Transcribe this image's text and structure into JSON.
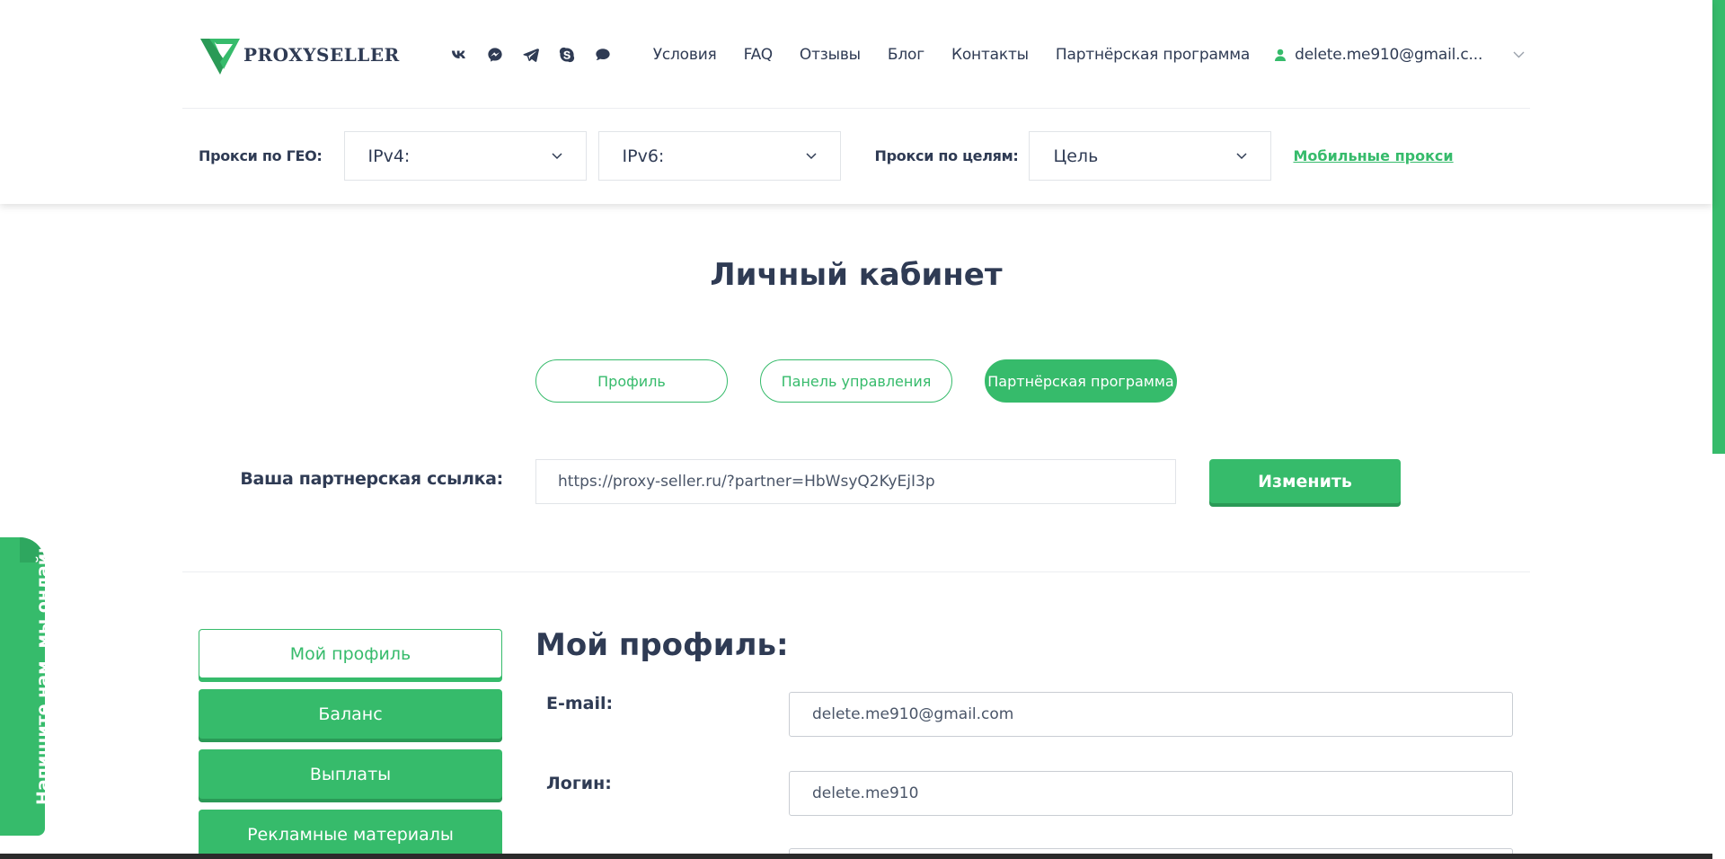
{
  "brand": {
    "name": "PROXYSELLER",
    "accent": "#36bb6b",
    "text_color": "#2f3b54"
  },
  "socials": [
    {
      "name": "vk-icon"
    },
    {
      "name": "messenger-icon"
    },
    {
      "name": "telegram-icon"
    },
    {
      "name": "skype-icon"
    },
    {
      "name": "chat-icon"
    }
  ],
  "nav": {
    "items": [
      "Условия",
      "FAQ",
      "Отзывы",
      "Блог",
      "Контакты",
      "Партнёрская программа"
    ],
    "user_email": "delete.me910@gmail.c..."
  },
  "geo_bar": {
    "geo_label": "Прокси по ГЕО:",
    "ipv4": "IPv4:",
    "ipv6": "IPv6:",
    "goal_label": "Прокси по целям:",
    "goal": "Цель",
    "mobile_link": "Мобильные прокси"
  },
  "page": {
    "title": "Личный кабинет"
  },
  "tabs": {
    "profile": "Профиль",
    "control_panel": "Панель управления",
    "partner_program": "Партнёрская программа",
    "active": "partner_program"
  },
  "partner": {
    "label": "Ваша партнерская ссылка:",
    "link": "https://proxy-seller.ru/?partner=HbWsyQ2KyEjI3p",
    "change_button": "Изменить"
  },
  "sidebar": {
    "items": [
      "Мой профиль",
      "Баланс",
      "Выплаты",
      "Рекламные материалы"
    ],
    "active_index": 0
  },
  "profile": {
    "title": "Мой профиль:",
    "email_label": "E-mail:",
    "email_value": "delete.me910@gmail.com",
    "login_label": "Логин:",
    "login_value": "delete.me910"
  },
  "chat_widget": {
    "label": "Напишите нам, мы онлайн!"
  }
}
